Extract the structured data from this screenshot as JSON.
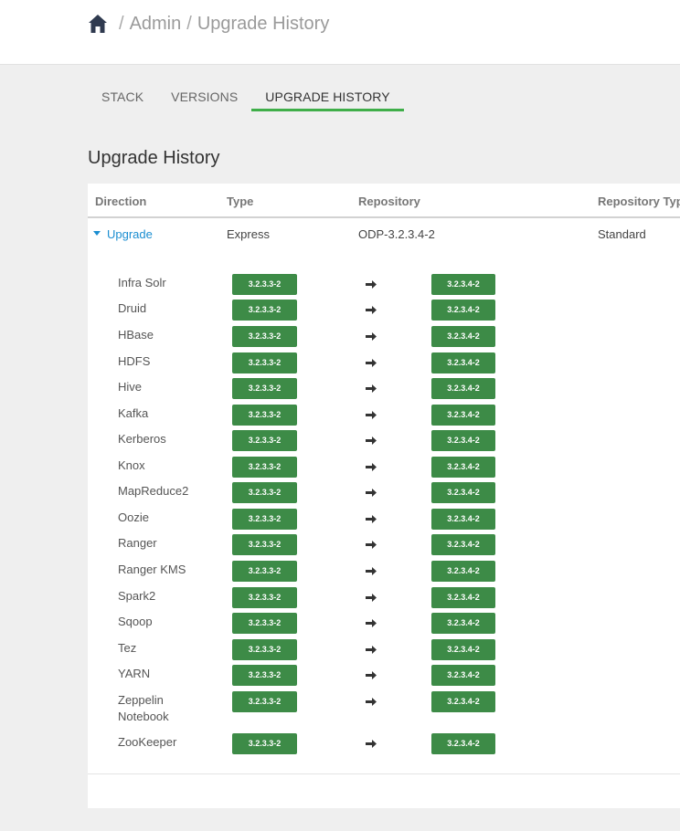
{
  "breadcrumb": {
    "home_icon": "home-icon",
    "items": [
      "Admin",
      "Upgrade History"
    ],
    "separator": "/"
  },
  "tabs": [
    {
      "label": "STACK",
      "active": false
    },
    {
      "label": "VERSIONS",
      "active": false
    },
    {
      "label": "UPGRADE HISTORY",
      "active": true
    }
  ],
  "page": {
    "title": "Upgrade History"
  },
  "table": {
    "headers": {
      "direction": "Direction",
      "type": "Type",
      "repository": "Repository",
      "repository_type": "Repository Type"
    },
    "summary": {
      "direction": "Upgrade",
      "type": "Express",
      "repository": "ODP-3.2.3.4-2",
      "repository_type": "Standard"
    },
    "services": [
      {
        "name": "Infra Solr",
        "from": "3.2.3.3-2",
        "to": "3.2.3.4-2"
      },
      {
        "name": "Druid",
        "from": "3.2.3.3-2",
        "to": "3.2.3.4-2"
      },
      {
        "name": "HBase",
        "from": "3.2.3.3-2",
        "to": "3.2.3.4-2"
      },
      {
        "name": "HDFS",
        "from": "3.2.3.3-2",
        "to": "3.2.3.4-2"
      },
      {
        "name": "Hive",
        "from": "3.2.3.3-2",
        "to": "3.2.3.4-2"
      },
      {
        "name": "Kafka",
        "from": "3.2.3.3-2",
        "to": "3.2.3.4-2"
      },
      {
        "name": "Kerberos",
        "from": "3.2.3.3-2",
        "to": "3.2.3.4-2"
      },
      {
        "name": "Knox",
        "from": "3.2.3.3-2",
        "to": "3.2.3.4-2"
      },
      {
        "name": "MapReduce2",
        "from": "3.2.3.3-2",
        "to": "3.2.3.4-2"
      },
      {
        "name": "Oozie",
        "from": "3.2.3.3-2",
        "to": "3.2.3.4-2"
      },
      {
        "name": "Ranger",
        "from": "3.2.3.3-2",
        "to": "3.2.3.4-2"
      },
      {
        "name": "Ranger KMS",
        "from": "3.2.3.3-2",
        "to": "3.2.3.4-2"
      },
      {
        "name": "Spark2",
        "from": "3.2.3.3-2",
        "to": "3.2.3.4-2"
      },
      {
        "name": "Sqoop",
        "from": "3.2.3.3-2",
        "to": "3.2.3.4-2"
      },
      {
        "name": "Tez",
        "from": "3.2.3.3-2",
        "to": "3.2.3.4-2"
      },
      {
        "name": "YARN",
        "from": "3.2.3.3-2",
        "to": "3.2.3.4-2"
      },
      {
        "name": "Zeppelin Notebook",
        "from": "3.2.3.3-2",
        "to": "3.2.3.4-2"
      },
      {
        "name": "ZooKeeper",
        "from": "3.2.3.3-2",
        "to": "3.2.3.4-2"
      }
    ]
  },
  "colors": {
    "accent_tab": "#3fae49",
    "badge_green": "#3d8b47",
    "link_blue": "#1b8ed1"
  }
}
